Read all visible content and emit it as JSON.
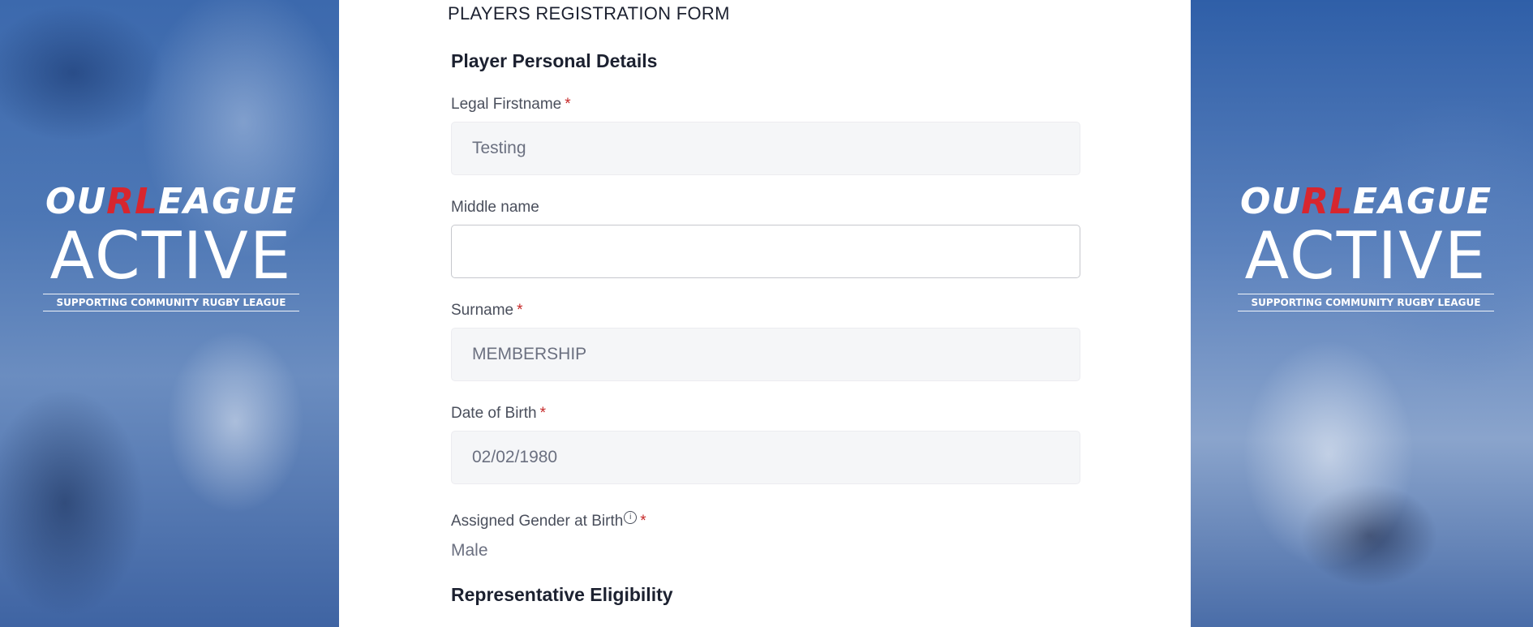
{
  "left_banner": {
    "brand_our": "OU",
    "brand_rl": "RL",
    "brand_league": "EAGUE",
    "brand_active": "ACTIVE",
    "tagline": "SUPPORTING COMMUNITY RUGBY LEAGUE"
  },
  "right_banner": {
    "brand_our": "OU",
    "brand_rl": "RL",
    "brand_league": "EAGUE",
    "brand_active": "ACTIVE",
    "tagline": "SUPPORTING COMMUNITY RUGBY LEAGUE"
  },
  "form": {
    "title": "PLAYERS REGISTRATION FORM",
    "personal_section_title": "Player Personal Details",
    "fields": {
      "firstname": {
        "label": "Legal Firstname",
        "required": "*",
        "value": "Testing"
      },
      "middlename": {
        "label": "Middle name",
        "value": ""
      },
      "surname": {
        "label": "Surname",
        "required": "*",
        "value": "MEMBERSHIP"
      },
      "dob": {
        "label": "Date of Birth",
        "required": "*",
        "value": "02/02/1980"
      },
      "gender": {
        "label": "Assigned Gender at Birth",
        "info_icon": "i",
        "required": "*",
        "value": "Male"
      }
    },
    "eligibility_section_title": "Representative Eligibility"
  },
  "colors": {
    "brand_red": "#d7262e",
    "required_red": "#c62828",
    "readonly_bg": "#f5f6f8",
    "banner_blue": "#3c69ad"
  },
  "icons": {
    "info": "info-icon"
  }
}
